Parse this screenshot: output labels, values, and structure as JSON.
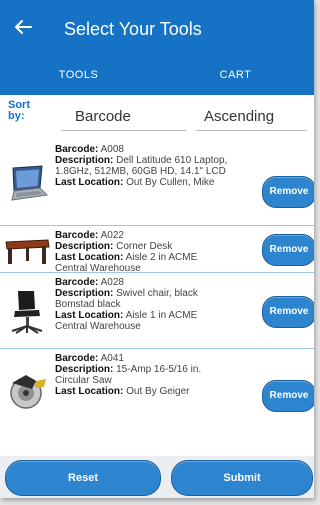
{
  "header": {
    "title": "Select Your Tools"
  },
  "tabs": [
    {
      "label": "TOOLS"
    },
    {
      "label": "CART"
    }
  ],
  "sort": {
    "label": "Sort by:",
    "field": "Barcode",
    "order": "Ascending"
  },
  "labels": {
    "barcode": "Barcode:",
    "description": "Description:",
    "location": "Last Location:"
  },
  "items": [
    {
      "barcode": "A008",
      "description": "Dell Latitude 610 Laptop, 1.8GHz, 512MB, 60GB HD, 14.1\" LCD",
      "location": "Out By Cullen, Mike",
      "button": "Remove",
      "icon": "laptop-icon"
    },
    {
      "barcode": "A022",
      "description": "Corner Desk",
      "location": "Aisle 2 in ACME Central Warehouse",
      "button": "Remove",
      "icon": "desk-icon"
    },
    {
      "barcode": "A028",
      "description": "Swivel chair, black Bomstad black",
      "location": "Aisle 1 in ACME Central Warehouse",
      "button": "Remove",
      "icon": "chair-icon"
    },
    {
      "barcode": "A041",
      "description": "15-Amp 16-5/16 in. Circular Saw",
      "location": "Out By Geiger",
      "button": "Remove",
      "icon": "saw-icon"
    }
  ],
  "footer": {
    "reset": "Reset",
    "submit": "Submit"
  },
  "colors": {
    "primary": "#1572c5",
    "button": "#2d84cf"
  }
}
